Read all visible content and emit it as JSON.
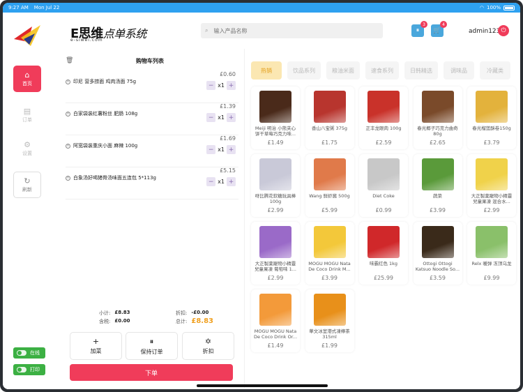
{
  "status": {
    "time": "9:27 AM",
    "date": "Mon Jul 22",
    "battery": "100%"
  },
  "brand": {
    "main": "E思维",
    "main2": "点单系统",
    "domain": "e-siwei.com"
  },
  "search": {
    "placeholder": "输入产品名称"
  },
  "header": {
    "orders_badge": "3",
    "cart_badge": "4",
    "user": "admin123"
  },
  "sidebar": {
    "items": [
      {
        "label": "首页",
        "icon": "home-icon"
      },
      {
        "label": "订单",
        "icon": "document-icon"
      },
      {
        "label": "设置",
        "icon": "gear-icon"
      },
      {
        "label": "刷新",
        "icon": "refresh-icon"
      }
    ],
    "toggles": [
      {
        "label": "在线"
      },
      {
        "label": "打印"
      }
    ]
  },
  "cart": {
    "title": "购物车列表",
    "items": [
      {
        "name": "印尼 营多捞面 鸡肉汤面 75g",
        "price": "£0.60",
        "qty": "x1"
      },
      {
        "name": "白家袋装红薯粉丝 肥肠 108g",
        "price": "£1.39",
        "qty": "x1"
      },
      {
        "name": "阿宽袋装重庆小面 麻辣 100g",
        "price": "£1.69",
        "qty": "x1"
      },
      {
        "name": "白象汤好喝猪骨汤味面五连包 5*113g",
        "price": "£5.15",
        "qty": "x1"
      }
    ],
    "subtotal_label": "小计:",
    "subtotal": "£8.83",
    "discount_label": "折扣:",
    "discount": "-£0.00",
    "tax_label": "含税:",
    "tax": "£0.00",
    "total_label": "总计:",
    "total": "£8.83",
    "actions": [
      {
        "label": "加菜",
        "icon": "plus-icon",
        "glyph": "+"
      },
      {
        "label": "保持订单",
        "icon": "pause-icon",
        "glyph": "⏸"
      },
      {
        "label": "折扣",
        "icon": "discount-icon",
        "glyph": "✡"
      }
    ],
    "submit": "下单"
  },
  "categories": [
    {
      "label": "热销",
      "active": true
    },
    {
      "label": "饮品系列"
    },
    {
      "label": "粮油米面"
    },
    {
      "label": "速食系列"
    },
    {
      "label": "日韩精选"
    },
    {
      "label": "调味品"
    },
    {
      "label": "冷藏类"
    }
  ],
  "products": [
    {
      "name": "Meiji 明治 小熊夹心饼干草莓巧克力味...",
      "price": "£1.49",
      "color": "#4a2a1a"
    },
    {
      "name": "香山八宝粥 375g",
      "price": "£1.75",
      "color": "#b8352e"
    },
    {
      "name": "正丰龙眼肉 100g",
      "price": "£2.59",
      "color": "#c9322a"
    },
    {
      "name": "春光椰子巧克力曲奇 80g",
      "price": "£2.65",
      "color": "#7a4a2a"
    },
    {
      "name": "春光榴莲酥卷150g",
      "price": "£3.79",
      "color": "#e3b23c"
    },
    {
      "name": "呀比腾花软糖玩具棒 100g",
      "price": "£2.99",
      "color": "#c9c9d8"
    },
    {
      "name": "Wang 鲜虾酱 500g",
      "price": "£5.99",
      "color": "#e07a4a"
    },
    {
      "name": "Diet Coke",
      "price": "£0.99",
      "color": "#c8c8c8"
    },
    {
      "name": "蔬菜",
      "price": "£3.99",
      "color": "#5a9a3a"
    },
    {
      "name": "大正製薬寵物小精靈兒童果凍 混合水...",
      "price": "£2.99",
      "color": "#f0d24a"
    },
    {
      "name": "大正製薬寵物小精靈兒童果凍 葡萄味 1...",
      "price": "£2.99",
      "color": "#9a6ac8"
    },
    {
      "name": "MOGU MOGU Nata De Coco Drink M...",
      "price": "£3.99",
      "color": "#f3c83a"
    },
    {
      "name": "味霸红色 1kg",
      "price": "£25.99",
      "color": "#d0282a"
    },
    {
      "name": "Ottogi Ottogi Katsuo Noodle So...",
      "price": "£3.59",
      "color": "#3a2a1a"
    },
    {
      "name": "Relx 暖弹 冻顶乌龙",
      "price": "£9.99",
      "color": "#8ac06a"
    },
    {
      "name": "MOGU MOGU Nata De Coco Drink Or...",
      "price": "£1.49",
      "color": "#f39a3a"
    },
    {
      "name": "華文冰室港式凍檸茶 315ml",
      "price": "£1.99",
      "color": "#e8901a"
    }
  ],
  "colors": {
    "accent": "#f03c5a",
    "status": "#2ea1f0",
    "online": "#3cb043"
  }
}
